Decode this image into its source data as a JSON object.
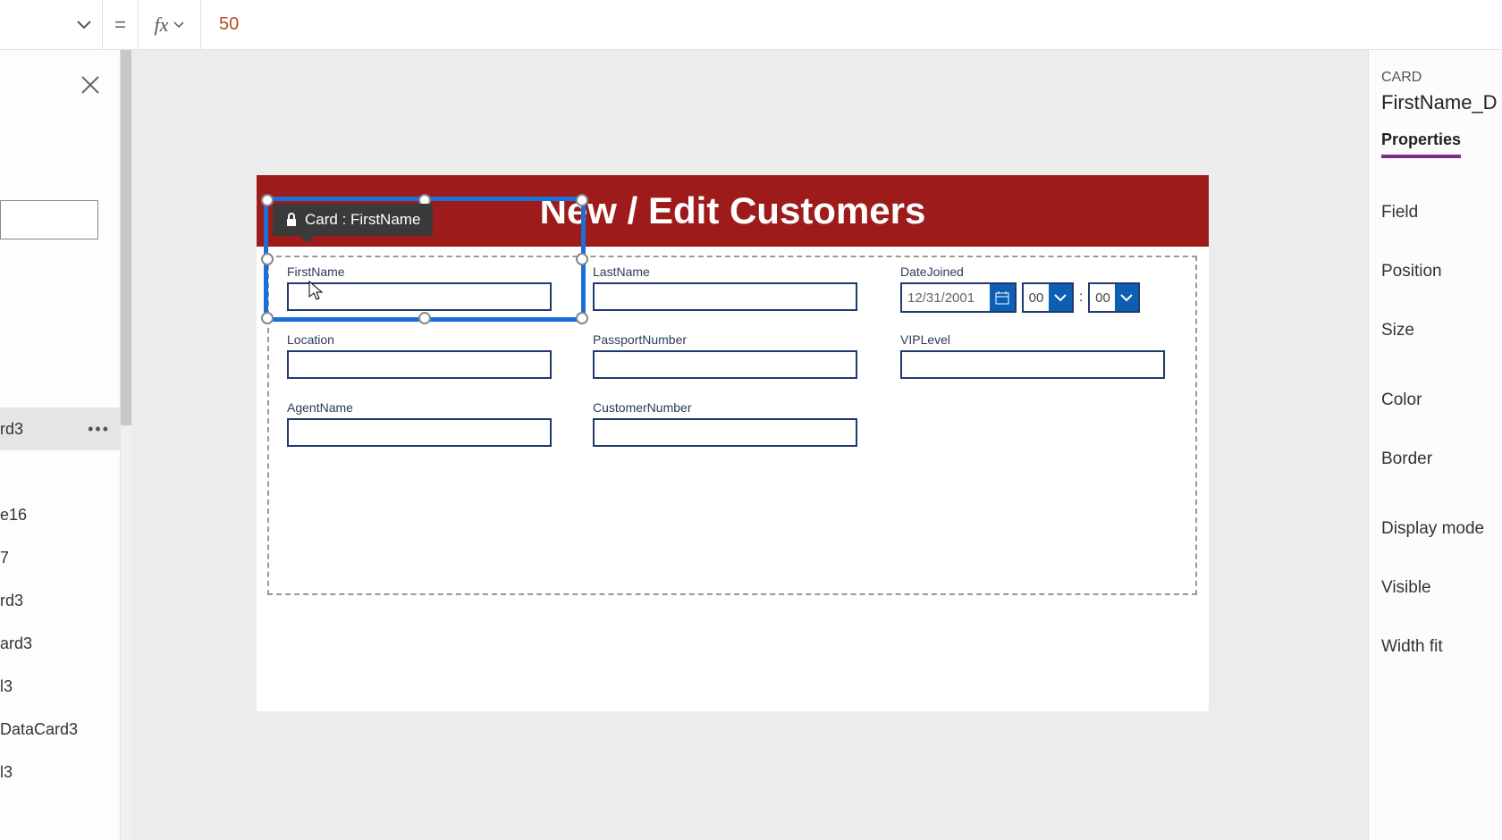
{
  "formula_bar": {
    "equals": "=",
    "fx": "fx",
    "value": "50"
  },
  "left_panel": {
    "search_placeholder": "",
    "selected_item": "rd3",
    "items": [
      "rd3",
      "",
      "e16",
      "7",
      "rd3",
      "ard3",
      "l3",
      "DataCard3",
      "l3"
    ]
  },
  "canvas": {
    "header_title": "New / Edit Customers",
    "selection_tooltip": "Card : FirstName",
    "fields": {
      "firstname": {
        "label": "FirstName",
        "value": ""
      },
      "lastname": {
        "label": "LastName",
        "value": ""
      },
      "datejoined": {
        "label": "DateJoined",
        "date": "12/31/2001",
        "hour": "00",
        "minute": "00"
      },
      "location": {
        "label": "Location",
        "value": ""
      },
      "passport": {
        "label": "PassportNumber",
        "value": ""
      },
      "vip": {
        "label": "VIPLevel",
        "value": ""
      },
      "agent": {
        "label": "AgentName",
        "value": ""
      },
      "custnum": {
        "label": "CustomerNumber",
        "value": ""
      }
    }
  },
  "right_panel": {
    "type_label": "CARD",
    "name": "FirstName_D",
    "tab": "Properties",
    "items": [
      "Field",
      "Position",
      "Size",
      "Color",
      "Border",
      "Display mode",
      "Visible",
      "Width fit"
    ]
  }
}
